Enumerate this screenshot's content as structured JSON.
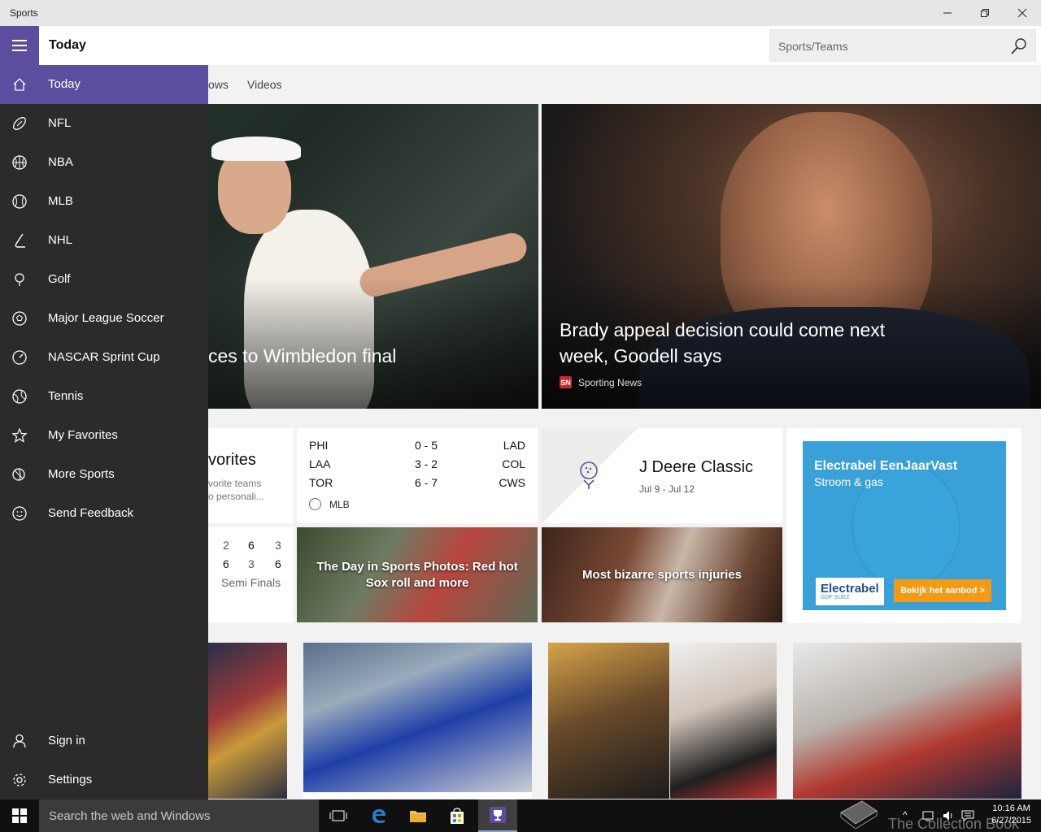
{
  "window": {
    "title": "Sports",
    "minimize_icon": "minimize-icon",
    "maximize_icon": "restore-icon",
    "close_icon": "close-icon"
  },
  "header": {
    "page_title": "Today",
    "search_placeholder": "Sports/Teams"
  },
  "tabs": [
    "ows",
    "Videos"
  ],
  "nav": {
    "items": [
      {
        "label": "Today",
        "icon": "home-icon",
        "active": true
      },
      {
        "label": "NFL",
        "icon": "football-icon"
      },
      {
        "label": "NBA",
        "icon": "basketball-icon"
      },
      {
        "label": "MLB",
        "icon": "baseball-icon"
      },
      {
        "label": "NHL",
        "icon": "hockey-icon"
      },
      {
        "label": "Golf",
        "icon": "golf-icon"
      },
      {
        "label": "Major League Soccer",
        "icon": "soccer-icon"
      },
      {
        "label": "NASCAR Sprint Cup",
        "icon": "speedometer-icon"
      },
      {
        "label": "Tennis",
        "icon": "tennis-icon"
      },
      {
        "label": "My Favorites",
        "icon": "star-icon"
      },
      {
        "label": "More Sports",
        "icon": "more-sports-icon"
      },
      {
        "label": "Send Feedback",
        "icon": "smiley-icon"
      }
    ],
    "footer": [
      {
        "label": "Sign in",
        "icon": "person-icon"
      },
      {
        "label": "Settings",
        "icon": "gear-icon"
      }
    ]
  },
  "hero": {
    "left_headline": "ces to Wimbledon final",
    "right_headline_line1": "Brady appeal decision could come next",
    "right_headline_line2": "week, Goodell says",
    "right_source": "Sporting News"
  },
  "favorites": {
    "title": "vorites",
    "desc_line1": "vorite teams",
    "desc_line2": "o personali..."
  },
  "scores": {
    "rows": [
      {
        "team1": "PHI",
        "score": "0  -  5",
        "team2": "LAD"
      },
      {
        "team1": "LAA",
        "score": "3  -  2",
        "team2": "COL"
      },
      {
        "team1": "TOR",
        "score": "6  -  7",
        "team2": "CWS"
      }
    ],
    "league": "MLB"
  },
  "golf": {
    "title": "J Deere Classic",
    "dates": "Jul 9 - Jul 12"
  },
  "ad": {
    "title": "Electrabel EenJaarVast",
    "subtitle": "Stroom & gas",
    "logo": "Electrabel",
    "logo_sub": "GDF SUEZ",
    "cta": "Bekijk het aanbod  >"
  },
  "tennis": {
    "row1": [
      "2",
      "6",
      "3"
    ],
    "row2": [
      "6",
      "3",
      "6"
    ],
    "round": "Semi Finals"
  },
  "photos": {
    "sox_caption": "The Day in Sports Photos: Red hot Sox roll and more",
    "injuries_caption": "Most bizarre sports injuries"
  },
  "taskbar": {
    "search_placeholder": "Search the web and Windows",
    "time": "10:16 AM",
    "date": "6/27/2015",
    "watermark": "The Collection Book"
  }
}
